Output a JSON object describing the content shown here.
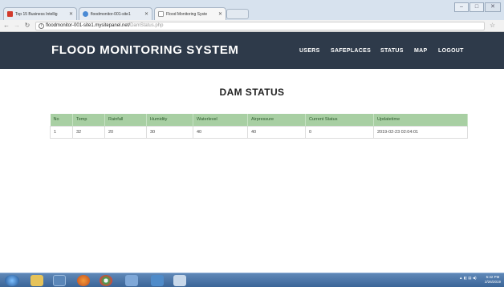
{
  "browser": {
    "tabs": [
      {
        "title": "Top 15 Business Intellig",
        "favicon_color": "#d23a2c"
      },
      {
        "title": "floodmonitor-001-site1",
        "favicon_color": "#4a8ad4"
      },
      {
        "title": "Flood Monitoring Syste",
        "favicon_color": "#9a9a9a"
      }
    ],
    "url_host": "floodmonitor-001-site1.mysitepanel.net/",
    "url_path": "DamStatus.php",
    "window_controls": [
      "–",
      "□",
      "✕"
    ]
  },
  "site": {
    "brand": "FLOOD MONITORING SYSTEM",
    "nav": [
      "USERS",
      "SAFEPLACES",
      "STATUS",
      "MAP",
      "LOGOUT"
    ]
  },
  "page": {
    "title": "DAM STATUS",
    "table": {
      "headers": [
        "No",
        "Temp",
        "Rainfall",
        "Humidity",
        "Waterlevel",
        "Airpressure",
        "Current Status",
        "Updatetime"
      ],
      "rows": [
        [
          "1",
          "32",
          "20",
          "30",
          "40",
          "40",
          "0",
          "2019-02-23 02:04:01"
        ]
      ]
    }
  },
  "taskbar": {
    "clock_time": "5:42 PM",
    "clock_date": "2/26/2019"
  }
}
